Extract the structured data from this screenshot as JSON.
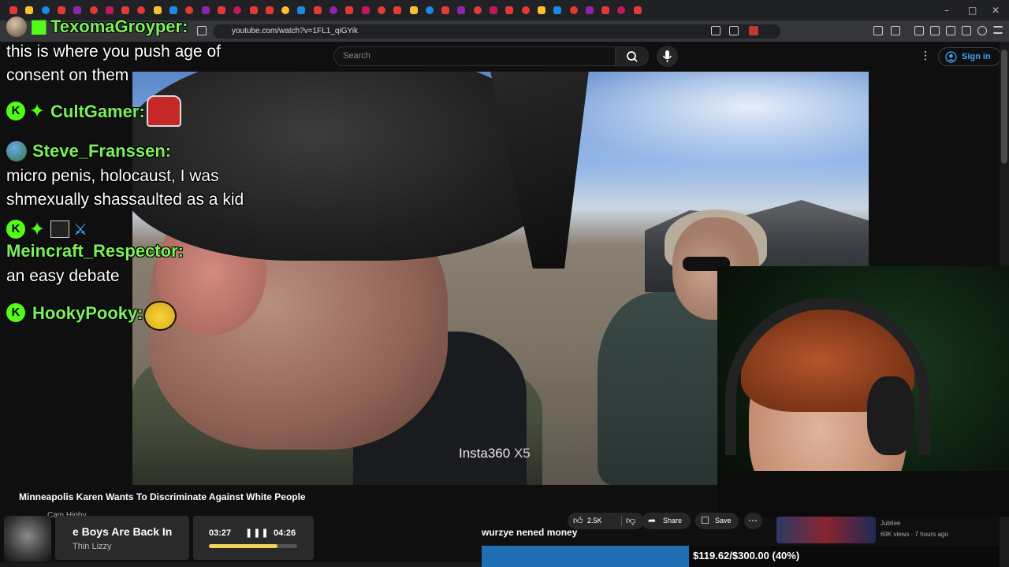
{
  "browser": {
    "url": "youtube.com/watch?v=1FL1_qiGYik",
    "tab_count": 40
  },
  "youtube": {
    "search_placeholder": "Search",
    "sign_in_label": "Sign in",
    "video_title": "Minneapolis Karen Wants To Discriminate Against White People",
    "channel_name": "Cam Higby",
    "like_count": "2.5K",
    "share_label": "Share",
    "save_label": "Save",
    "watermark": "Insta360",
    "watermark_model": "X5",
    "recommended": {
      "channel": "Jubilee",
      "meta": "69K views · 7 hours ago"
    }
  },
  "chat": {
    "messages": [
      {
        "user": "TexomaGroyper:",
        "text_lines": [
          "this is where you push age of",
          "consent on them"
        ]
      },
      {
        "user": "CultGamer:",
        "text_lines": []
      },
      {
        "user": "Steve_Franssen:",
        "text_lines": [
          "micro penis, holocaust, I was",
          "shmexually shassaulted as a kid"
        ]
      },
      {
        "user": "Meincraft_Respector:",
        "text_lines": [
          "an easy debate"
        ]
      },
      {
        "user": "HookyPooky:",
        "text_lines": []
      }
    ]
  },
  "now_playing": {
    "title": "e Boys Are Back In",
    "artist": "Thin Lizzy",
    "current_time": "03:27",
    "total_time": "04:26",
    "progress_fraction": 0.78
  },
  "caption": "wurzye nened money",
  "donation_goal": {
    "label": "$119.62/$300.00 (40%)",
    "fraction": 0.4
  },
  "colors": {
    "chat_username": "#7cf05a",
    "kick_green": "#53fc18",
    "link_blue": "#3ea6ff",
    "goal_fill": "#1f6fb5",
    "progress_yellow": "#f2d45b"
  }
}
